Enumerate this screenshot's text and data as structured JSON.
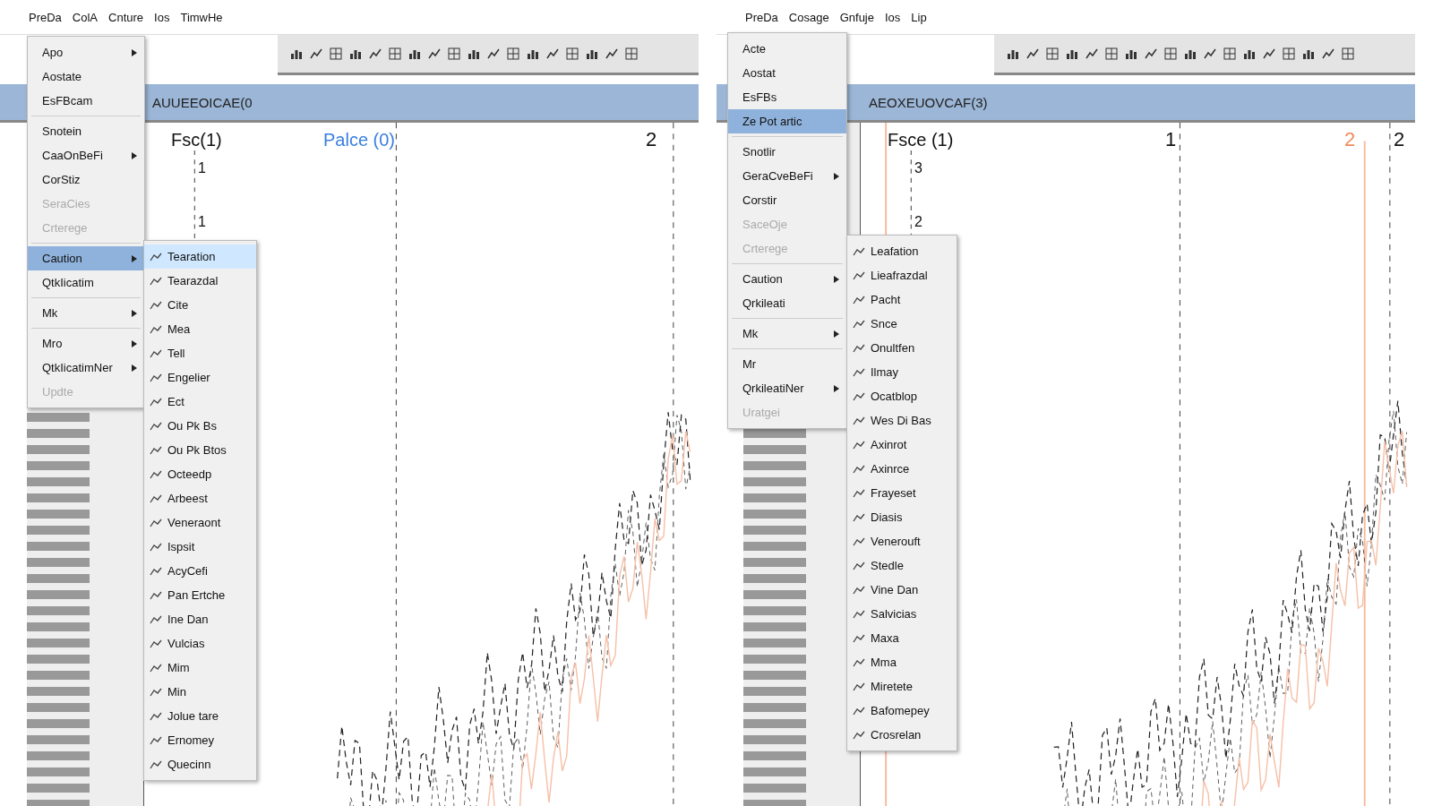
{
  "panels": [
    {
      "menubar": [
        "PreDa",
        "ColA",
        "Cnture",
        "Ios",
        "TimwHe"
      ],
      "title": "AUUEEOICAE(0",
      "chart": {
        "header": "Fsc(1)",
        "series_label": "Palce (0)",
        "markers": [
          {
            "label": "2",
            "kind": "plain"
          }
        ],
        "yticks": [
          "1",
          "1"
        ]
      },
      "menu": [
        {
          "kind": "item",
          "label": "Apo",
          "has_submenu": true,
          "disabled": false,
          "selected": false
        },
        {
          "kind": "item",
          "label": "Aostate",
          "has_submenu": false,
          "disabled": false,
          "selected": false
        },
        {
          "kind": "item",
          "label": "EsFBcam",
          "has_submenu": false,
          "disabled": false,
          "selected": false
        },
        {
          "kind": "separator"
        },
        {
          "kind": "item",
          "label": "Snotein",
          "has_submenu": false,
          "disabled": false,
          "selected": false
        },
        {
          "kind": "item",
          "label": "CaaOnBeFi",
          "has_submenu": true,
          "disabled": false,
          "selected": false
        },
        {
          "kind": "item",
          "label": "CorStiz",
          "has_submenu": false,
          "disabled": false,
          "selected": false
        },
        {
          "kind": "item",
          "label": "SeraCies",
          "has_submenu": false,
          "disabled": true,
          "selected": false
        },
        {
          "kind": "item",
          "label": "Crterege",
          "has_submenu": false,
          "disabled": true,
          "selected": false
        },
        {
          "kind": "separator"
        },
        {
          "kind": "item",
          "label": "Caution",
          "has_submenu": true,
          "disabled": false,
          "selected": true
        },
        {
          "kind": "item",
          "label": "QtkIicatim",
          "has_submenu": false,
          "disabled": false,
          "selected": false
        },
        {
          "kind": "separator"
        },
        {
          "kind": "item",
          "label": "Mk",
          "has_submenu": true,
          "disabled": false,
          "selected": false
        },
        {
          "kind": "separator"
        },
        {
          "kind": "item",
          "label": "Mro",
          "has_submenu": true,
          "disabled": false,
          "selected": false
        },
        {
          "kind": "item",
          "label": "QtkIicatimNer",
          "has_submenu": true,
          "disabled": false,
          "selected": false
        },
        {
          "kind": "item",
          "label": "Updte",
          "has_submenu": false,
          "disabled": true,
          "selected": false
        }
      ],
      "submenu": [
        {
          "label": "Tearation",
          "selected": true
        },
        {
          "label": "Tearazdal",
          "selected": false
        },
        {
          "label": "Cite",
          "selected": false
        },
        {
          "label": "Mea",
          "selected": false
        },
        {
          "label": "Tell",
          "selected": false
        },
        {
          "label": "Engelier",
          "selected": false
        },
        {
          "label": "Ect",
          "selected": false
        },
        {
          "label": "Ou Pk Bs",
          "selected": false
        },
        {
          "label": "Ou Pk Btos",
          "selected": false
        },
        {
          "label": "Octeedp",
          "selected": false
        },
        {
          "label": "Arbeest",
          "selected": false
        },
        {
          "label": "Veneraont",
          "selected": false
        },
        {
          "label": "Ispsit",
          "selected": false
        },
        {
          "label": "AcyCefi",
          "selected": false
        },
        {
          "label": "Pan Ertche",
          "selected": false
        },
        {
          "label": "Ine Dan",
          "selected": false
        },
        {
          "label": "Vulcias",
          "selected": false
        },
        {
          "label": "Mim",
          "selected": false
        },
        {
          "label": "Min",
          "selected": false
        },
        {
          "label": "Jolue tare",
          "selected": false
        },
        {
          "label": "Ernomey",
          "selected": false
        },
        {
          "label": "Quecinn",
          "selected": false
        }
      ]
    },
    {
      "menubar": [
        "PreDa",
        "Cosage",
        "Gnfuje",
        "Ios",
        "Lip"
      ],
      "title": "AEOXEUOVCAF(3)",
      "chart": {
        "header": "Fsce (1)",
        "markers": [
          {
            "label": "1",
            "kind": "plain"
          },
          {
            "label": "2",
            "kind": "accent"
          },
          {
            "label": "2",
            "kind": "plain"
          }
        ],
        "yticks": [
          "3",
          "2"
        ]
      },
      "menu": [
        {
          "kind": "item",
          "label": "Acte",
          "has_submenu": false,
          "disabled": false,
          "selected": false
        },
        {
          "kind": "item",
          "label": "Aostat",
          "has_submenu": false,
          "disabled": false,
          "selected": false
        },
        {
          "kind": "item",
          "label": "EsFBs",
          "has_submenu": false,
          "disabled": false,
          "selected": false
        },
        {
          "kind": "item",
          "label": "Ze Pot artic",
          "has_submenu": false,
          "disabled": false,
          "selected": true
        },
        {
          "kind": "separator"
        },
        {
          "kind": "item",
          "label": "Snotlir",
          "has_submenu": false,
          "disabled": false,
          "selected": false
        },
        {
          "kind": "item",
          "label": "GeraCveBeFi",
          "has_submenu": true,
          "disabled": false,
          "selected": false
        },
        {
          "kind": "item",
          "label": "Corstir",
          "has_submenu": false,
          "disabled": false,
          "selected": false
        },
        {
          "kind": "item",
          "label": "SaceOje",
          "has_submenu": false,
          "disabled": true,
          "selected": false
        },
        {
          "kind": "item",
          "label": "Crterege",
          "has_submenu": false,
          "disabled": true,
          "selected": false
        },
        {
          "kind": "separator"
        },
        {
          "kind": "item",
          "label": "Caution",
          "has_submenu": true,
          "disabled": false,
          "selected": false
        },
        {
          "kind": "item",
          "label": "Qrkileati",
          "has_submenu": false,
          "disabled": false,
          "selected": false
        },
        {
          "kind": "separator"
        },
        {
          "kind": "item",
          "label": "Mk",
          "has_submenu": true,
          "disabled": false,
          "selected": false
        },
        {
          "kind": "separator"
        },
        {
          "kind": "item",
          "label": "Mr",
          "has_submenu": false,
          "disabled": false,
          "selected": false
        },
        {
          "kind": "item",
          "label": "QrkileatiNer",
          "has_submenu": true,
          "disabled": false,
          "selected": false
        },
        {
          "kind": "item",
          "label": "Uratgei",
          "has_submenu": false,
          "disabled": true,
          "selected": false
        }
      ],
      "submenu": [
        {
          "label": "Leafation",
          "selected": false
        },
        {
          "label": "Lieafrazdal",
          "selected": false
        },
        {
          "label": "Pacht",
          "selected": false
        },
        {
          "label": "Snce",
          "selected": false
        },
        {
          "label": "Onultfen",
          "selected": false
        },
        {
          "label": "Ilmay",
          "selected": false
        },
        {
          "label": "Ocatblop",
          "selected": false
        },
        {
          "label": "Wes Di Bas",
          "selected": false
        },
        {
          "label": "Axinrot",
          "selected": false
        },
        {
          "label": "Axinrce",
          "selected": false
        },
        {
          "label": "Frayeset",
          "selected": false
        },
        {
          "label": "Diasis",
          "selected": false
        },
        {
          "label": "Venerouft",
          "selected": false
        },
        {
          "label": "Stedle",
          "selected": false
        },
        {
          "label": "Vine Dan",
          "selected": false
        },
        {
          "label": "Salvicias",
          "selected": false
        },
        {
          "label": "Maxa",
          "selected": false
        },
        {
          "label": "Mma",
          "selected": false
        },
        {
          "label": "Miretete",
          "selected": false
        },
        {
          "label": "Bafomepey",
          "selected": false
        },
        {
          "label": "Crosrelan",
          "selected": false
        }
      ]
    }
  ]
}
